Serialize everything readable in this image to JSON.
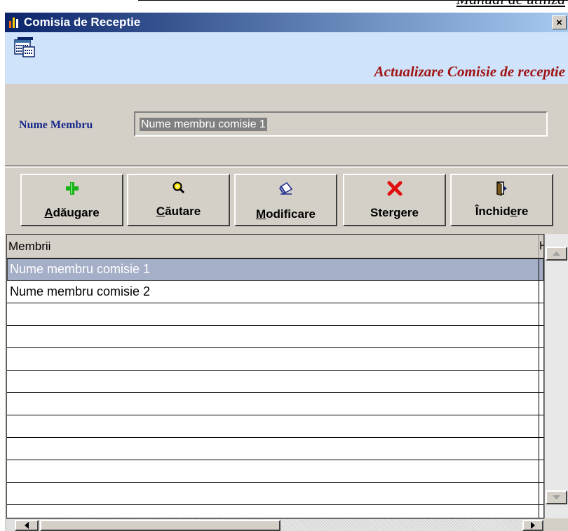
{
  "document_header": "Manual de utiliza",
  "window": {
    "title": "Comisia de Receptie",
    "close_label": "×"
  },
  "banner": {
    "icon": "form-grid-icon",
    "title": "Actualizare Comisie de receptie"
  },
  "form": {
    "member_label": "Nume Membru",
    "member_value": "Nume membru comisie 1"
  },
  "toolbar": [
    {
      "name": "add-button",
      "icon": "green-plus-icon",
      "pre": "",
      "accel": "A",
      "post": "dăugare"
    },
    {
      "name": "search-button",
      "icon": "magnifier-icon",
      "pre": "",
      "accel": "C",
      "post": "ăutare"
    },
    {
      "name": "modify-button",
      "icon": "eraser-icon",
      "pre": "",
      "accel": "M",
      "post": "odificare"
    },
    {
      "name": "delete-button",
      "icon": "red-x-icon",
      "pre": "Ster",
      "accel": "g",
      "post": "ere"
    },
    {
      "name": "close-button",
      "icon": "exit-door-icon",
      "pre": "Închid",
      "accel": "e",
      "post": "re"
    }
  ],
  "grid": {
    "column_header": "Membrii",
    "column2_header": "H",
    "rows": [
      "Nume membru comisie 1",
      "Nume membru comisie 2"
    ],
    "selected_row_index": 0
  },
  "colors": {
    "titlebar_start": "#0a246a",
    "titlebar_end": "#a6caf0",
    "banner_bg": "#cfe4fb",
    "banner_title": "#a01414",
    "label_color": "#1a2a8a",
    "selection_bg": "#a6afc8"
  }
}
